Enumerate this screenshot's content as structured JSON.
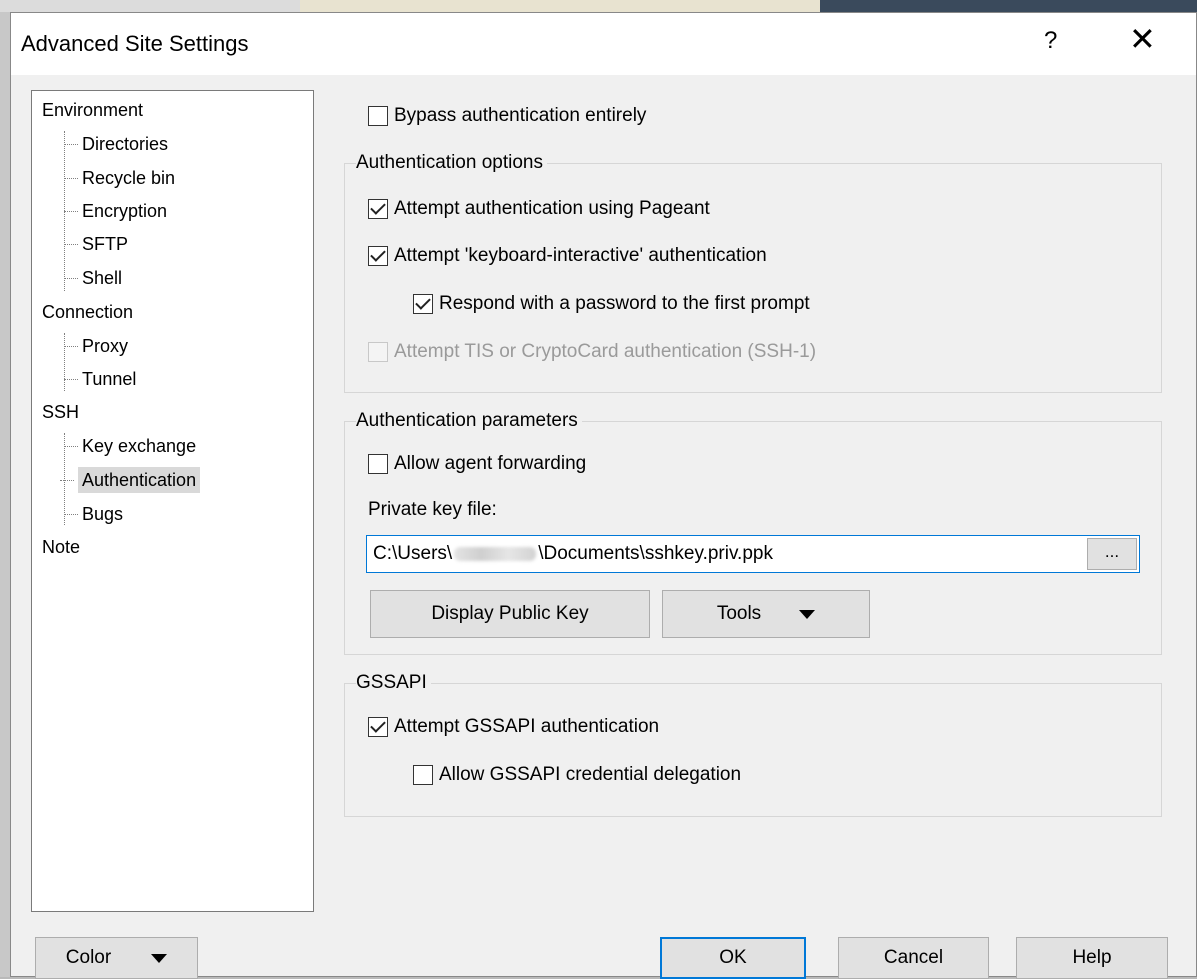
{
  "dialog": {
    "title": "Advanced Site Settings",
    "help_glyph": "?",
    "close_glyph": "✕"
  },
  "tree": {
    "environment": "Environment",
    "directories": "Directories",
    "recycle_bin": "Recycle bin",
    "encryption": "Encryption",
    "sftp": "SFTP",
    "shell": "Shell",
    "connection": "Connection",
    "proxy": "Proxy",
    "tunnel": "Tunnel",
    "ssh": "SSH",
    "key_exchange": "Key exchange",
    "authentication": "Authentication",
    "bugs": "Bugs",
    "note": "Note"
  },
  "auth": {
    "bypass": {
      "label": "Bypass authentication entirely",
      "checked": false
    },
    "options_group": "Authentication options",
    "pageant": {
      "label": "Attempt authentication using Pageant",
      "checked": true
    },
    "kbd_interactive": {
      "label": "Attempt 'keyboard-interactive' authentication",
      "checked": true
    },
    "respond_password": {
      "label": "Respond with a password to the first prompt",
      "checked": true
    },
    "tis": {
      "label": "Attempt TIS or CryptoCard authentication (SSH-1)",
      "checked": false,
      "disabled": true
    },
    "params_group": "Authentication parameters",
    "agent_forwarding": {
      "label": "Allow agent forwarding",
      "checked": false
    },
    "private_key_label": "Private key file:",
    "private_key_prefix": "C:\\Users\\",
    "private_key_suffix": "\\Documents\\sshkey.priv.ppk",
    "browse_label": "...",
    "display_public_key": "Display Public Key",
    "tools": "Tools",
    "gssapi_group": "GSSAPI",
    "gssapi_attempt": {
      "label": "Attempt GSSAPI authentication",
      "checked": true
    },
    "gssapi_delegation": {
      "label": "Allow GSSAPI credential delegation",
      "checked": false
    }
  },
  "footer": {
    "color": "Color",
    "ok": "OK",
    "cancel": "Cancel",
    "help": "Help"
  }
}
